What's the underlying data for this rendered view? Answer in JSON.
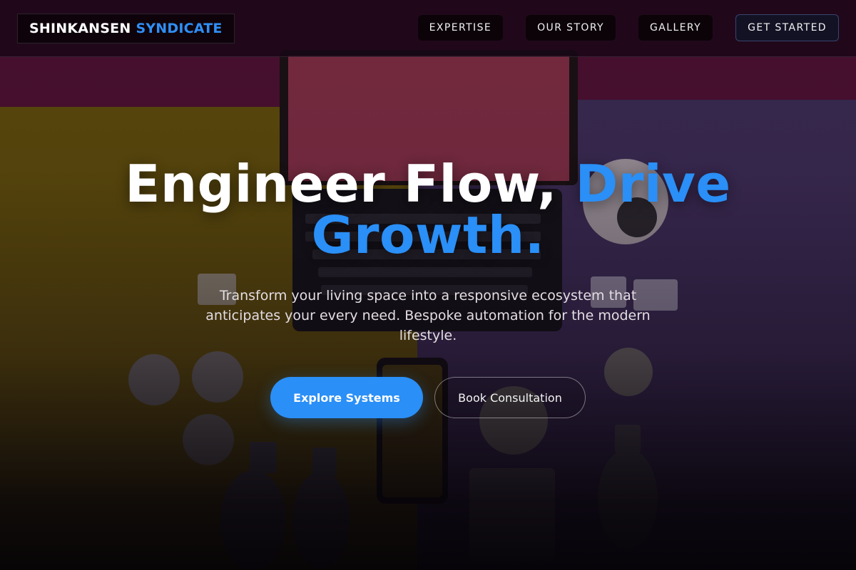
{
  "header": {
    "brand_part1": "SHINKANSEN",
    "brand_part2": "SYNDICATE",
    "nav": [
      {
        "label": "EXPERTISE"
      },
      {
        "label": "OUR STORY"
      },
      {
        "label": "GALLERY"
      },
      {
        "label": "GET STARTED"
      }
    ]
  },
  "hero": {
    "headline_plain": "Engineer Flow,",
    "headline_accent": "Drive Growth.",
    "subtitle": "Transform your living space into a responsive ecosystem that anticipates your every need. Bespoke automation for the modern lifestyle.",
    "primary_cta": "Explore Systems",
    "secondary_cta": "Book Consultation"
  },
  "colors": {
    "accent": "#2a8ff7",
    "background_yellow": "#6e5a10",
    "background_magenta": "#5a1438",
    "background_purple": "#3a2650"
  }
}
